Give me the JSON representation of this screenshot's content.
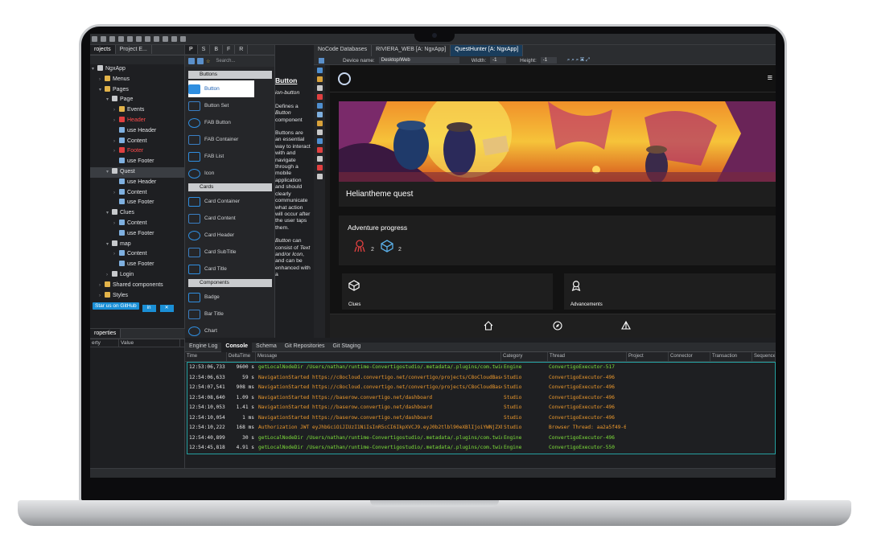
{
  "left_panel": {
    "tabs": [
      "rojects",
      "Project E..."
    ],
    "tree": [
      {
        "label": "NgxApp",
        "indent": 0,
        "icon": "page",
        "arrow": "▾"
      },
      {
        "label": "Menus",
        "indent": 1,
        "icon": "folder",
        "arrow": "›"
      },
      {
        "label": "Pages",
        "indent": 1,
        "icon": "folder",
        "arrow": "▾"
      },
      {
        "label": "Page",
        "indent": 2,
        "icon": "page",
        "arrow": "▾"
      },
      {
        "label": "Events",
        "indent": 3,
        "icon": "folder",
        "arrow": "›"
      },
      {
        "label": "Header",
        "indent": 3,
        "icon": "red",
        "arrow": "›",
        "red": true
      },
      {
        "label": "use Header",
        "indent": 3,
        "icon": "comp",
        "arrow": ""
      },
      {
        "label": "Content",
        "indent": 3,
        "icon": "comp",
        "arrow": "›"
      },
      {
        "label": "Footer",
        "indent": 3,
        "icon": "red",
        "arrow": "›",
        "red": true
      },
      {
        "label": "use Footer",
        "indent": 3,
        "icon": "comp",
        "arrow": ""
      },
      {
        "label": "Quest",
        "indent": 2,
        "icon": "page",
        "arrow": "▾",
        "selected": true
      },
      {
        "label": "use Header",
        "indent": 3,
        "icon": "comp",
        "arrow": ""
      },
      {
        "label": "Content",
        "indent": 3,
        "icon": "comp",
        "arrow": "›"
      },
      {
        "label": "use Footer",
        "indent": 3,
        "icon": "comp",
        "arrow": ""
      },
      {
        "label": "Clues",
        "indent": 2,
        "icon": "page",
        "arrow": "▾"
      },
      {
        "label": "Content",
        "indent": 3,
        "icon": "comp",
        "arrow": "›"
      },
      {
        "label": "use Footer",
        "indent": 3,
        "icon": "comp",
        "arrow": ""
      },
      {
        "label": "map",
        "indent": 2,
        "icon": "page",
        "arrow": "▾"
      },
      {
        "label": "Content",
        "indent": 3,
        "icon": "comp",
        "arrow": "›"
      },
      {
        "label": "use Footer",
        "indent": 3,
        "icon": "comp",
        "arrow": ""
      },
      {
        "label": "Login",
        "indent": 2,
        "icon": "page",
        "arrow": "›"
      },
      {
        "label": "Shared components",
        "indent": 1,
        "icon": "folder",
        "arrow": "›"
      },
      {
        "label": "Styles",
        "indent": 1,
        "icon": "folder",
        "arrow": "›"
      }
    ],
    "github_button": "Star us on GitHub",
    "properties_tab": "roperties",
    "prop_col_property": "erty",
    "prop_col_value": "Value"
  },
  "palette": {
    "tabs": [
      "P",
      "S",
      "B",
      "F",
      "R"
    ],
    "search_placeholder": "Search...",
    "categories": [
      {
        "name": "Buttons",
        "items": [
          "Button",
          "Button Set",
          "FAB Button",
          "FAB Container",
          "FAB List",
          "Icon"
        ]
      },
      {
        "name": "Cards",
        "items": [
          "Card Container",
          "Card Content",
          "Card Header",
          "Card SubTitle",
          "Card Title"
        ]
      },
      {
        "name": "Components",
        "items": [
          "Badge",
          "Bar Title",
          "Chart"
        ]
      }
    ],
    "selected_item": "Button"
  },
  "doc": {
    "title": "Button",
    "tag": "ion-button",
    "p1_pre": "Defines a ",
    "p1_em": "Button",
    "p1_post": " component",
    "p2": "Buttons are an essential way to interact with and navigate through a mobile application and should clearly communicate what action will occur after the user taps them.",
    "p3_em1": "Button",
    "p3_mid": " can consist of ",
    "p3_em2": "Text",
    "p3_mid2": " and/or ",
    "p3_em3": "Icon",
    "p3_post": ", and can be enhanced with a"
  },
  "editor": {
    "tabs": [
      "NoCode Databases",
      "RIVIERA_WEB [A: NgxApp]",
      "QuestHunter [A: NgxApp]"
    ],
    "active_tab": 2,
    "device_label": "Device name:",
    "device_value": "Desktop/Web",
    "width_label": "Width:",
    "width_value": "-1",
    "height_label": "Height:",
    "height_value": "-1"
  },
  "app": {
    "hero_title": "Heliantheme quest",
    "progress_title": "Adventure progress",
    "progress_stats": [
      {
        "icon": "kraken-icon",
        "value": "2"
      },
      {
        "icon": "cube-icon",
        "value": "2"
      }
    ],
    "cards": [
      "Clues",
      "Advancements"
    ],
    "menu_icon": "≡"
  },
  "bottom": {
    "tabs": [
      "Engine Log",
      "Console",
      "Schema",
      "Git Repositories",
      "Git Staging"
    ],
    "columns": [
      "Time",
      "DeltaTime",
      "Message",
      "Category",
      "Thread",
      "Project",
      "Connector",
      "Transaction",
      "Sequence"
    ],
    "rows": [
      {
        "time": "12:53:06,733",
        "delta": "9600 s",
        "msg": "getLocalNodeDir /Users/nathan/runtime-Convertigostudio/.metadata/.plugins/com.twins",
        "cat": "Engine",
        "thread": "ConvertigoExecutor-517",
        "color": "green"
      },
      {
        "time": "12:54:06,633",
        "delta": "59 s",
        "msg": "NavigationStarted https://c8ocloud.convertigo.net/convertigo/projects/C8oCloudBaser",
        "cat": "Studio",
        "thread": "ConvertigoExecutor-496",
        "color": "orange"
      },
      {
        "time": "12:54:07,541",
        "delta": "908 ms",
        "msg": "NavigationStarted https://c8ocloud.convertigo.net/convertigo/projects/C8oCloudBaser",
        "cat": "Studio",
        "thread": "ConvertigoExecutor-496",
        "color": "orange"
      },
      {
        "time": "12:54:08,640",
        "delta": "1.09 s",
        "msg": "NavigationStarted https://baserow.convertigo.net/dashboard",
        "cat": "Studio",
        "thread": "ConvertigoExecutor-496",
        "color": "orange"
      },
      {
        "time": "12:54:10,053",
        "delta": "1.41 s",
        "msg": "NavigationStarted https://baserow.convertigo.net/dashboard",
        "cat": "Studio",
        "thread": "ConvertigoExecutor-496",
        "color": "orange"
      },
      {
        "time": "12:54:10,054",
        "delta": "1 ms",
        "msg": "NavigationStarted https://baserow.convertigo.net/dashboard",
        "cat": "Studio",
        "thread": "ConvertigoExecutor-496",
        "color": "orange"
      },
      {
        "time": "12:54:10,222",
        "delta": "168 ms",
        "msg": "Authorization JWT eyJhbGciOiJIUzI1NiIsInR5cCI6IkpXVCJ9.eyJ0b2tlbl90eXBlIjoiYWNjZXNz",
        "cat": "Studio",
        "thread": "Browser Thread: aa2a5f49-6",
        "color": "orange"
      },
      {
        "time": "12:54:40,899",
        "delta": "30 s",
        "msg": "getLocalNodeDir /Users/nathan/runtime-Convertigostudio/.metadata/.plugins/com.twins",
        "cat": "Engine",
        "thread": "ConvertigoExecutor-496",
        "color": "green"
      },
      {
        "time": "12:54:45,818",
        "delta": "4.91 s",
        "msg": "getLocalNodeDir /Users/nathan/runtime-Convertigostudio/.metadata/.plugins/com.twins",
        "cat": "Engine",
        "thread": "ConvertigoExecutor-550",
        "color": "green"
      }
    ]
  },
  "colors": {
    "accent": "#1a8fd6",
    "green_log": "#7ee03a",
    "orange_log": "#ef9a2c",
    "red_node": "#ff4a4a"
  }
}
